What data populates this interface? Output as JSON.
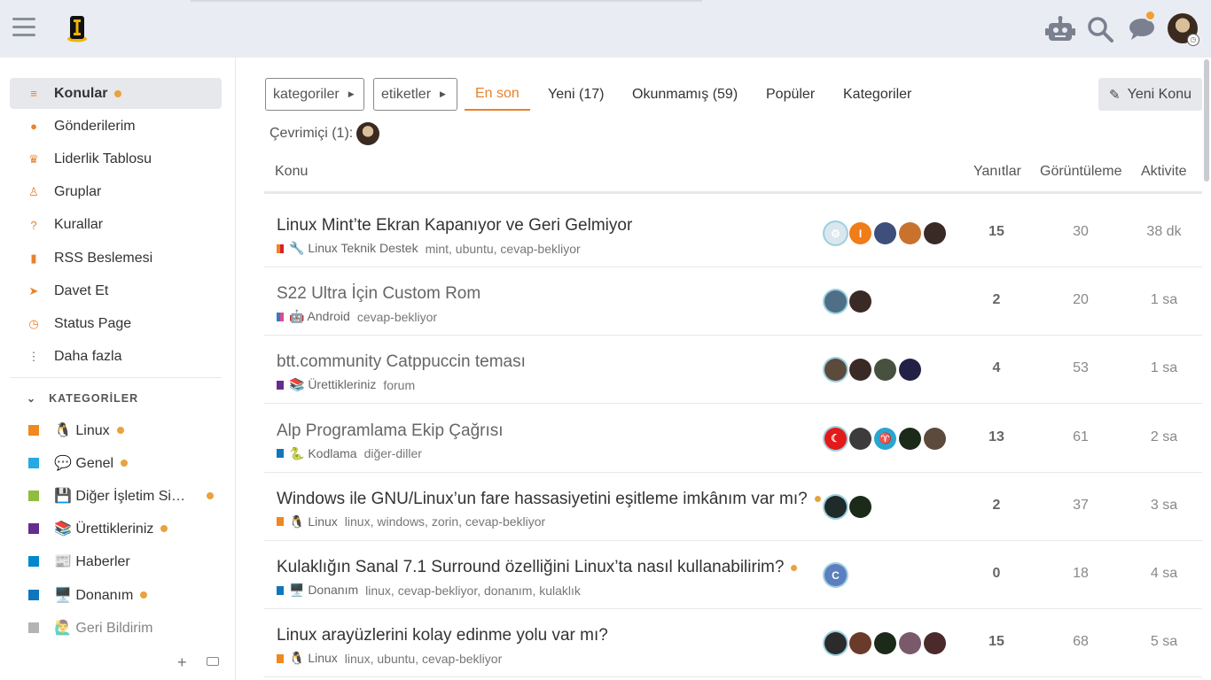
{
  "colors": {
    "accent": "#e8822b",
    "new_dot": "#e8a33d",
    "header_bg": "#e9ecf2"
  },
  "header": {
    "icons": [
      "robot-icon",
      "search-icon",
      "chat-icon",
      "user-avatar"
    ]
  },
  "sidebar": {
    "items": [
      {
        "label": "Konular",
        "icon": "layers-icon",
        "glyph": "≡",
        "active": true,
        "dot": true
      },
      {
        "label": "Gönderilerim",
        "icon": "user-icon",
        "glyph": "●"
      },
      {
        "label": "Liderlik Tablosu",
        "icon": "crown-icon",
        "glyph": "♛"
      },
      {
        "label": "Gruplar",
        "icon": "penguin-icon",
        "glyph": "♙"
      },
      {
        "label": "Kurallar",
        "icon": "question-icon",
        "glyph": "?"
      },
      {
        "label": "RSS Beslemesi",
        "icon": "bookmark-icon",
        "glyph": "▮"
      },
      {
        "label": "Davet Et",
        "icon": "paper-plane-icon",
        "glyph": "➤"
      },
      {
        "label": "Status Page",
        "icon": "clock-icon",
        "glyph": "◷"
      },
      {
        "label": "Daha fazla",
        "icon": "more-vertical-icon",
        "glyph": "⋮"
      }
    ],
    "categories_header": "KATEGORİLER",
    "categories": [
      {
        "label": "🐧 Linux",
        "color": "#f0881e",
        "dot": true
      },
      {
        "label": "💬 Genel",
        "color": "#25aae1",
        "dot": true
      },
      {
        "label": "💾 Diğer İşletim Si…",
        "color": "#8ebd3f",
        "dot": true
      },
      {
        "label": "📚 Ürettikleriniz",
        "color": "#652d90",
        "dot": true
      },
      {
        "label": "📰 Haberler",
        "color": "#0088cc",
        "dot": false
      },
      {
        "label": "🖥️ Donanım",
        "color": "#0e76bd",
        "dot": true
      },
      {
        "label": "🙋‍♂️ Geri Bildirim",
        "color": "#808281",
        "dot": false
      }
    ]
  },
  "nav": {
    "categories_dropdown": "kategoriler",
    "tags_dropdown": "etiketler",
    "tabs": [
      "En son",
      "Yeni (17)",
      "Okunmamış (59)",
      "Popüler",
      "Kategoriler"
    ],
    "new_topic": "Yeni Konu"
  },
  "online": {
    "label": "Çevrimiçi (1):"
  },
  "table": {
    "headers": {
      "topic": "Konu",
      "replies": "Yanıtlar",
      "views": "Görüntüleme",
      "activity": "Aktivite"
    },
    "rows": [
      {
        "title": "Linux Mint’te Ekran Kapanıyor ve Geri Gelmiyor",
        "unread": false,
        "new": false,
        "category": "🔧 Linux Teknik Destek",
        "cat_colors": [
          "#f0881e",
          "#d6232b"
        ],
        "tags": "mint, ubuntu, cevap-bekliyor",
        "posters": [
          {
            "bg": "#dbe7ee",
            "t": "⚙"
          },
          {
            "bg": "#f07c1a",
            "t": "I"
          },
          {
            "bg": "#3d4f7a",
            "t": ""
          },
          {
            "bg": "#c9722e",
            "t": ""
          },
          {
            "bg": "#3a2a26",
            "t": ""
          }
        ],
        "replies": "15",
        "views": "30",
        "activity": "38 dk"
      },
      {
        "title": "S22 Ultra İçin Custom Rom",
        "unread": true,
        "new": false,
        "category": "🤖 Android",
        "cat_colors": [
          "#2f7fc1",
          "#e24a8d"
        ],
        "tags": "cevap-bekliyor",
        "posters": [
          {
            "bg": "#4e6f86",
            "t": ""
          },
          {
            "bg": "#3a2a26",
            "t": ""
          }
        ],
        "replies": "2",
        "views": "20",
        "activity": "1 sa"
      },
      {
        "title": "btt.community Catppuccin teması",
        "unread": true,
        "new": false,
        "category": "📚 Ürettikleriniz",
        "cat_colors": [
          "#652d90",
          "#652d90"
        ],
        "tags": "forum",
        "posters": [
          {
            "bg": "#5c4a3c",
            "t": ""
          },
          {
            "bg": "#3a2a26",
            "t": ""
          },
          {
            "bg": "#48503f",
            "t": ""
          },
          {
            "bg": "#232046",
            "t": ""
          }
        ],
        "replies": "4",
        "views": "53",
        "activity": "1 sa"
      },
      {
        "title": "Alp Programlama Ekip Çağrısı",
        "unread": true,
        "new": false,
        "category": "🐍 Kodlama",
        "cat_colors": [
          "#0e76bd",
          "#0e76bd"
        ],
        "tags": "diğer-diller",
        "posters": [
          {
            "bg": "#e21a1a",
            "t": "☾"
          },
          {
            "bg": "#3c3c3c",
            "t": ""
          },
          {
            "bg": "#27a7d0",
            "t": "♈"
          },
          {
            "bg": "#1c2a1a",
            "t": ""
          },
          {
            "bg": "#5c4a3c",
            "t": ""
          }
        ],
        "replies": "13",
        "views": "61",
        "activity": "2 sa"
      },
      {
        "title": "Windows ile GNU/Linux’un fare hassasiyetini eşitleme imkânım var mı?",
        "unread": false,
        "new": true,
        "category": "🐧 Linux",
        "cat_colors": [
          "#f0881e",
          "#f0881e"
        ],
        "tags": "linux, windows, zorin, cevap-bekliyor",
        "posters": [
          {
            "bg": "#1f2a2a",
            "t": ""
          },
          {
            "bg": "#1c2a1a",
            "t": ""
          }
        ],
        "replies": "2",
        "views": "37",
        "activity": "3 sa"
      },
      {
        "title": "Kulaklığın Sanal 7.1 Surround özelliğini Linux’ta nasıl kullanabilirim?",
        "unread": false,
        "new": true,
        "category": "🖥️ Donanım",
        "cat_colors": [
          "#0e76bd",
          "#0e76bd"
        ],
        "tags": "linux, cevap-bekliyor, donanım, kulaklık",
        "posters": [
          {
            "bg": "#5b7fbf",
            "t": "C"
          }
        ],
        "replies": "0",
        "views": "18",
        "activity": "4 sa"
      },
      {
        "title": "Linux arayüzlerini kolay edinme yolu var mı?",
        "unread": false,
        "new": false,
        "category": "🐧 Linux",
        "cat_colors": [
          "#f0881e",
          "#f0881e"
        ],
        "tags": "linux, ubuntu, cevap-bekliyor",
        "posters": [
          {
            "bg": "#2b2b2b",
            "t": ""
          },
          {
            "bg": "#6a3b2a",
            "t": ""
          },
          {
            "bg": "#1c2a1a",
            "t": ""
          },
          {
            "bg": "#7a5a6a",
            "t": ""
          },
          {
            "bg": "#4a2a2a",
            "t": ""
          }
        ],
        "replies": "15",
        "views": "68",
        "activity": "5 sa"
      }
    ]
  }
}
